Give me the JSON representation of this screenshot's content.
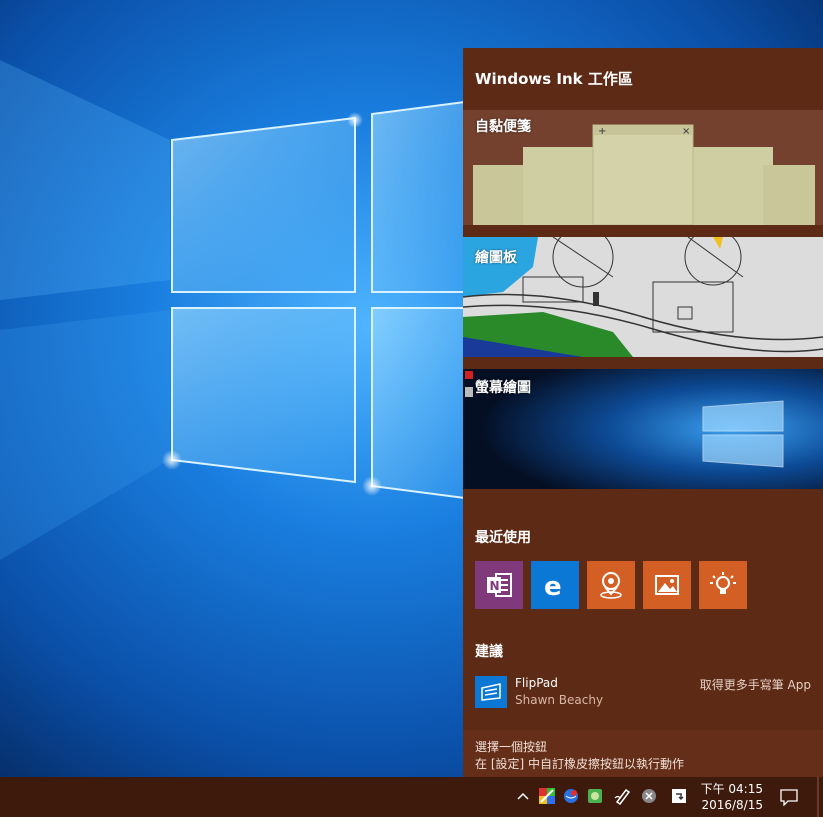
{
  "panel": {
    "title": "Windows Ink 工作區",
    "tiles": {
      "sticky_notes": "自黏便箋",
      "sketchpad": "繪圖板",
      "screen_sketch": "螢幕繪圖"
    },
    "recent_title": "最近使用",
    "recent_apps": [
      {
        "icon": "onenote-icon",
        "color": "#80397b"
      },
      {
        "icon": "edge-icon",
        "color": "#0a78d4"
      },
      {
        "icon": "maps-icon",
        "color": "#d35f25"
      },
      {
        "icon": "photos-icon",
        "color": "#d35f25"
      },
      {
        "icon": "tips-icon",
        "color": "#d35f25"
      }
    ],
    "suggest_title": "建議",
    "suggestion": {
      "name": "FlipPad",
      "publisher": "Shawn Beachy",
      "link": "取得更多手寫筆 App"
    },
    "footer_line1": "選擇一個按鈕",
    "footer_line2": "在 [設定] 中自訂橡皮擦按鈕以執行動作"
  },
  "taskbar": {
    "clock_time": "下午 04:15",
    "clock_date": "2016/8/15"
  }
}
